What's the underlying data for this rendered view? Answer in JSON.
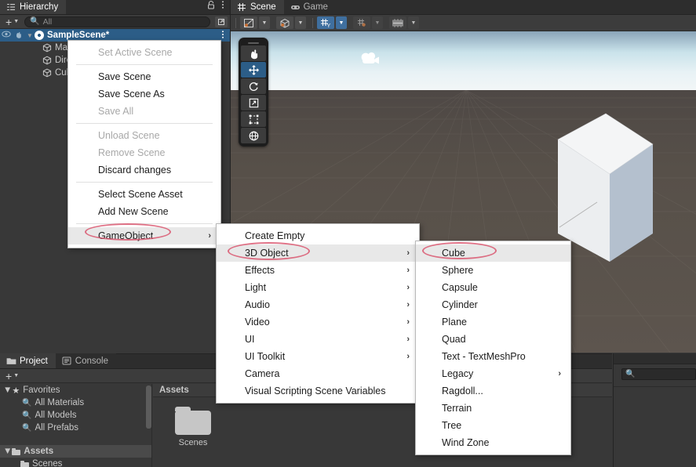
{
  "app": "Unity Editor",
  "hierarchy": {
    "tab_label": "Hierarchy",
    "tab_icon": "hierarchy-icon",
    "lock_icon": "lock-icon",
    "kebab_icon": "kebab-menu-icon",
    "create_label": "+",
    "search_placeholder": "All",
    "search_value": "",
    "search_icon": "search-icon",
    "expand_icon": "expand-window-icon",
    "rows": [
      {
        "label": "SampleScene*",
        "icon": "unity-scene-icon",
        "selected": true,
        "depth": 0
      },
      {
        "label": "Main Camera",
        "icon": "gameobject-cube-icon",
        "selected": false,
        "depth": 1
      },
      {
        "label": "Directional Light",
        "icon": "gameobject-cube-icon",
        "selected": false,
        "depth": 1
      },
      {
        "label": "Cube",
        "icon": "gameobject-cube-icon",
        "selected": false,
        "depth": 1
      }
    ]
  },
  "scene": {
    "tabs": [
      {
        "label": "Scene",
        "icon": "scene-grid-icon",
        "active": true
      },
      {
        "label": "Game",
        "icon": "game-controller-icon",
        "active": false
      }
    ],
    "toolbar": [
      {
        "name": "shading-mode-button",
        "icon": "shaded-draw-mode-icon",
        "active": false,
        "dropdown": true
      },
      {
        "name": "2d-3d-view-button",
        "icon": "scene-visibility-cube-icon",
        "active": false,
        "dropdown": true
      },
      {
        "name": "gizmo-toggle-button",
        "icon": "grid-axis-y-icon",
        "active": true,
        "dropdown": true
      },
      {
        "name": "snap-increment-button",
        "icon": "grid-snap-icon",
        "active": false,
        "dropdown": true
      },
      {
        "name": "gizmos-button",
        "icon": "gizmos-icon",
        "active": false,
        "dropdown": true
      }
    ],
    "tools": [
      {
        "name": "hand-tool",
        "icon": "hand-icon",
        "active": false
      },
      {
        "name": "move-tool",
        "icon": "move-arrows-icon",
        "active": true
      },
      {
        "name": "rotate-tool",
        "icon": "rotate-icon",
        "active": false
      },
      {
        "name": "scale-tool",
        "icon": "scale-icon",
        "active": false
      },
      {
        "name": "rect-tool",
        "icon": "rect-transform-icon",
        "active": false
      },
      {
        "name": "transform-tool",
        "icon": "transform-icon",
        "active": false
      }
    ],
    "objects": [
      {
        "name": "cube-mesh",
        "label": "Cube"
      },
      {
        "name": "cloud-gizmo",
        "label": "Cloud"
      }
    ]
  },
  "project": {
    "tabs": [
      {
        "label": "Project",
        "icon": "folder-icon",
        "active": true
      },
      {
        "label": "Console",
        "icon": "console-icon",
        "active": false
      }
    ],
    "create_label": "+",
    "tree": [
      {
        "label": "Favorites",
        "icon": "star-icon",
        "depth": 0,
        "twisty": "▼",
        "highlight": false
      },
      {
        "label": "All Materials",
        "icon": "search-icon",
        "depth": 1,
        "twisty": "",
        "highlight": false
      },
      {
        "label": "All Models",
        "icon": "search-icon",
        "depth": 1,
        "twisty": "",
        "highlight": false
      },
      {
        "label": "All Prefabs",
        "icon": "search-icon",
        "depth": 1,
        "twisty": "",
        "highlight": false
      },
      {
        "label": "",
        "icon": "",
        "depth": 0,
        "twisty": "",
        "highlight": false
      },
      {
        "label": "Assets",
        "icon": "folder-icon",
        "depth": 0,
        "twisty": "▼",
        "highlight": true
      },
      {
        "label": "Scenes",
        "icon": "folder-icon",
        "depth": 1,
        "twisty": "",
        "highlight": false
      }
    ],
    "breadcrumb": "Assets",
    "items": [
      {
        "label": "Scenes",
        "icon": "folder-icon"
      }
    ]
  },
  "inspector_strip": {
    "search_placeholder": "",
    "search_icon": "search-icon"
  },
  "menus": {
    "scene_context": {
      "name": "scene-context-menu",
      "items": [
        {
          "label": "Set Active Scene",
          "disabled": true,
          "submenu": false,
          "highlight": false
        },
        {
          "separator": true
        },
        {
          "label": "Save Scene",
          "disabled": false,
          "submenu": false,
          "highlight": false
        },
        {
          "label": "Save Scene As",
          "disabled": false,
          "submenu": false,
          "highlight": false
        },
        {
          "label": "Save All",
          "disabled": true,
          "submenu": false,
          "highlight": false
        },
        {
          "separator": true
        },
        {
          "label": "Unload Scene",
          "disabled": true,
          "submenu": false,
          "highlight": false
        },
        {
          "label": "Remove Scene",
          "disabled": true,
          "submenu": false,
          "highlight": false
        },
        {
          "label": "Discard changes",
          "disabled": false,
          "submenu": false,
          "highlight": false
        },
        {
          "separator": true
        },
        {
          "label": "Select Scene Asset",
          "disabled": false,
          "submenu": false,
          "highlight": false
        },
        {
          "label": "Add New Scene",
          "disabled": false,
          "submenu": false,
          "highlight": false
        },
        {
          "separator": true
        },
        {
          "label": "GameObject",
          "disabled": false,
          "submenu": true,
          "highlight": true
        }
      ]
    },
    "gameobject_menu": {
      "name": "gameobject-submenu",
      "items": [
        {
          "label": "Create Empty",
          "submenu": false,
          "highlight": false
        },
        {
          "label": "3D Object",
          "submenu": true,
          "highlight": true
        },
        {
          "label": "Effects",
          "submenu": true,
          "highlight": false
        },
        {
          "label": "Light",
          "submenu": true,
          "highlight": false
        },
        {
          "label": "Audio",
          "submenu": true,
          "highlight": false
        },
        {
          "label": "Video",
          "submenu": true,
          "highlight": false
        },
        {
          "label": "UI",
          "submenu": true,
          "highlight": false
        },
        {
          "label": "UI Toolkit",
          "submenu": true,
          "highlight": false
        },
        {
          "label": "Camera",
          "submenu": false,
          "highlight": false
        },
        {
          "label": "Visual Scripting Scene Variables",
          "submenu": false,
          "highlight": false
        }
      ]
    },
    "threed_object_menu": {
      "name": "3d-object-submenu",
      "items": [
        {
          "label": "Cube",
          "submenu": false,
          "highlight": true
        },
        {
          "label": "Sphere",
          "submenu": false,
          "highlight": false
        },
        {
          "label": "Capsule",
          "submenu": false,
          "highlight": false
        },
        {
          "label": "Cylinder",
          "submenu": false,
          "highlight": false
        },
        {
          "label": "Plane",
          "submenu": false,
          "highlight": false
        },
        {
          "label": "Quad",
          "submenu": false,
          "highlight": false
        },
        {
          "label": "Text - TextMeshPro",
          "submenu": false,
          "highlight": false
        },
        {
          "label": "Legacy",
          "submenu": true,
          "highlight": false
        },
        {
          "label": "Ragdoll...",
          "submenu": false,
          "highlight": false
        },
        {
          "label": "Terrain",
          "submenu": false,
          "highlight": false
        },
        {
          "label": "Tree",
          "submenu": false,
          "highlight": false
        },
        {
          "label": "Wind Zone",
          "submenu": false,
          "highlight": false
        }
      ]
    }
  },
  "annotations": [
    {
      "name": "gameobject-highlight-ellipse",
      "target": "GameObject"
    },
    {
      "name": "3d-object-highlight-ellipse",
      "target": "3D Object"
    },
    {
      "name": "cube-highlight-ellipse",
      "target": "Cube"
    }
  ],
  "colors": {
    "panel_bg": "#383838",
    "tab_bg": "#2d2d2d",
    "selection_blue": "#2c5d87",
    "menu_bg": "#ffffff",
    "menu_highlight": "#e8e8e8",
    "annotation_red": "#d9526b",
    "accent_blue": "#3f6f9f"
  }
}
